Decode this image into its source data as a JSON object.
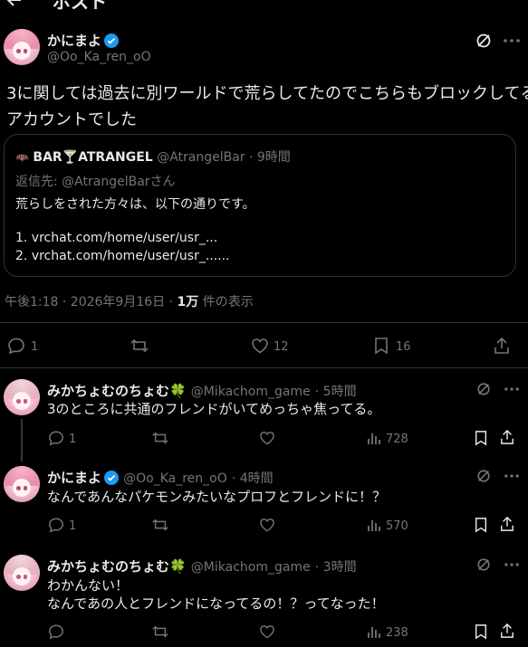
{
  "header": {
    "title": "ポスト"
  },
  "post": {
    "display_name": "かにまよ",
    "handle": "@Oo_Ka_ren_oO",
    "text_line1": "3に関しては過去に別ワールドで荒らしてたのでこちらもブロックしてる",
    "text_line2": "アカウントでした",
    "quote": {
      "emoji": "🦇🍸",
      "name": "BAR🍸ATRANGEL",
      "handle": "@AtrangelBar",
      "time": "· 9時間",
      "reply_to": "返信先: @AtrangelBarさん",
      "line1": "荒らしをされた方々は、以下の通りです。",
      "line2": "1. vrchat.com/home/user/usr_...",
      "line3": "2. vrchat.com/home/user/usr_......"
    },
    "meta_time": "午後1:18 · 2026年9月16日 · ",
    "views_count": "1万",
    "views_label": " 件の表示",
    "replies": "1",
    "likes": "12",
    "bookmarks": "16"
  },
  "replies": [
    {
      "display_name": "みかちょむのちょむ🍀",
      "handle": "@Mikachom_game",
      "time": "· 5時間",
      "text": "3のところに共通のフレンドがいてめっちゃ焦ってる。",
      "text2": "",
      "replies": "1",
      "views": "728"
    },
    {
      "display_name": "かにまよ",
      "handle": "@Oo_Ka_ren_oO",
      "time": "· 4時間",
      "text": "なんであんなパケモンみたいなプロフとフレンドに！？",
      "text2": "",
      "replies": "1",
      "views": "570"
    },
    {
      "display_name": "みかちょむのちょむ🍀",
      "handle": "@Mikachom_game",
      "time": "· 3時間",
      "text": "わかんない！",
      "text2": "なんであの人とフレンドになってるの！？ってなった！",
      "replies": "",
      "views": "238"
    }
  ],
  "colors": {
    "bg": "#000000",
    "text": "#e7e9ea",
    "muted": "#71767b",
    "border": "#2f3336",
    "verified": "#1d9bf0"
  }
}
